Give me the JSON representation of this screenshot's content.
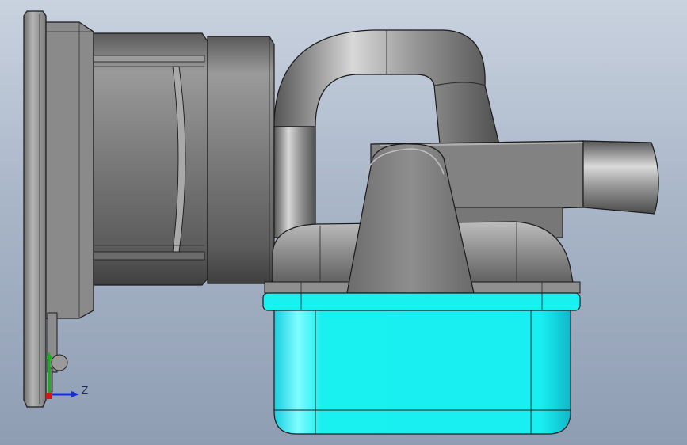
{
  "viewport": {
    "background_top": "#c9d2df",
    "background_bottom": "#8f9db3"
  },
  "model": {
    "body_color": "#7f7f7f",
    "body_highlight": "#c9c9c9",
    "body_shadow": "#4d4d4d",
    "tank_color": "#19f0f0",
    "tank_highlight": "#7ffcff",
    "tank_shadow": "#0fb7c7",
    "edge_color": "#1a1a1a"
  },
  "triad": {
    "z_label": "Z",
    "x_color": "#d01818",
    "y_color": "#18b018",
    "z_color": "#1830d0"
  }
}
